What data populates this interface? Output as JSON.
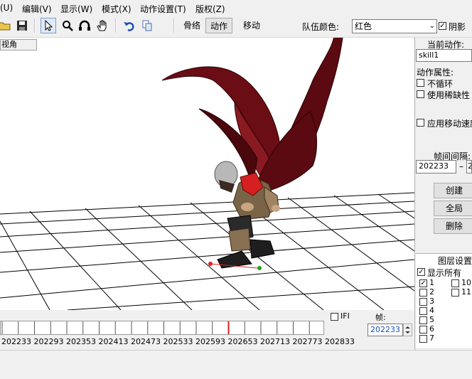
{
  "menu": {
    "items": [
      "(U)",
      "编辑(V)",
      "显示(W)",
      "模式(X)",
      "动作设置(T)",
      "版权(Z)"
    ]
  },
  "toolbar": {
    "tabs": [
      "骨络",
      "动作",
      "移动"
    ],
    "team_color_label": "队伍颜色:",
    "team_color_value": "红色",
    "shadow_label": "阴影",
    "shadow_checked": true
  },
  "viewport": {
    "label": "视角"
  },
  "right_panel": {
    "current_action_label": "当前动作:",
    "current_action_value": "skill1",
    "action_props_label": "动作属性:",
    "no_loop_label": "不循环",
    "use_rare_label": "使用稀缺性",
    "apply_move_speed_label": "应用移动速度",
    "frame_interval_label": "帧间间隔:",
    "frame_start": "202233",
    "frame_dash": "–",
    "frame_end": "2",
    "create_button": "创建",
    "global_button": "全局",
    "delete_button": "删除",
    "layer_settings_label": "图层设置",
    "show_all_label": "显示所有",
    "show_all_checked": true,
    "layers": [
      {
        "label": "1",
        "checked": true
      },
      {
        "label": "2",
        "checked": false
      },
      {
        "label": "3",
        "checked": false
      },
      {
        "label": "4",
        "checked": false
      },
      {
        "label": "5",
        "checked": false
      },
      {
        "label": "6",
        "checked": false
      },
      {
        "label": "7",
        "checked": false
      },
      {
        "label": "10",
        "checked": false
      },
      {
        "label": "11",
        "checked": false
      }
    ]
  },
  "timeline": {
    "ifi_label": "IFI",
    "frame_label": "帧:",
    "current_frame": "202233",
    "tick_labels": [
      "202233",
      "202293",
      "202353",
      "202413",
      "202473",
      "202533",
      "202593",
      "202653",
      "202713",
      "202773",
      "202833"
    ],
    "playhead_frame": 202653
  },
  "colors": {
    "playhead": "#e02020",
    "wing": "#5a0a10",
    "armor_red": "#d42020"
  }
}
